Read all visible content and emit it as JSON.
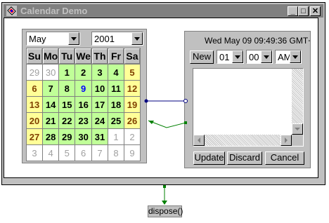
{
  "window": {
    "title": "Calendar Demo",
    "minimize": "_",
    "maximize": "□",
    "close": "✕"
  },
  "calendar": {
    "month": "May",
    "year": "2001",
    "weekdays": [
      "Su",
      "Mo",
      "Tu",
      "We",
      "Th",
      "Fr",
      "Sa"
    ],
    "weeks": [
      [
        "29",
        "30",
        "1",
        "2",
        "3",
        "4",
        "5"
      ],
      [
        "6",
        "7",
        "8",
        "9",
        "10",
        "11",
        "12"
      ],
      [
        "13",
        "14",
        "15",
        "16",
        "17",
        "18",
        "19"
      ],
      [
        "20",
        "21",
        "22",
        "23",
        "24",
        "25",
        "26"
      ],
      [
        "27",
        "28",
        "29",
        "30",
        "31",
        "1",
        "2"
      ],
      [
        "3",
        "4",
        "5",
        "6",
        "7",
        "8",
        "9"
      ]
    ]
  },
  "editor": {
    "datetime": "Wed May 09 09:49:36 GMT+",
    "new_label": "New",
    "hour": "01",
    "minute": "00",
    "ampm": "AM",
    "update_label": "Update",
    "discard_label": "Discard",
    "cancel_label": "Cancel"
  },
  "dispose_label": "dispose()",
  "colors": {
    "weekday_cell": "#c0ff98",
    "weekend_cell": "#ffff98",
    "today_text": "#0000ff",
    "connector": "#008000"
  }
}
